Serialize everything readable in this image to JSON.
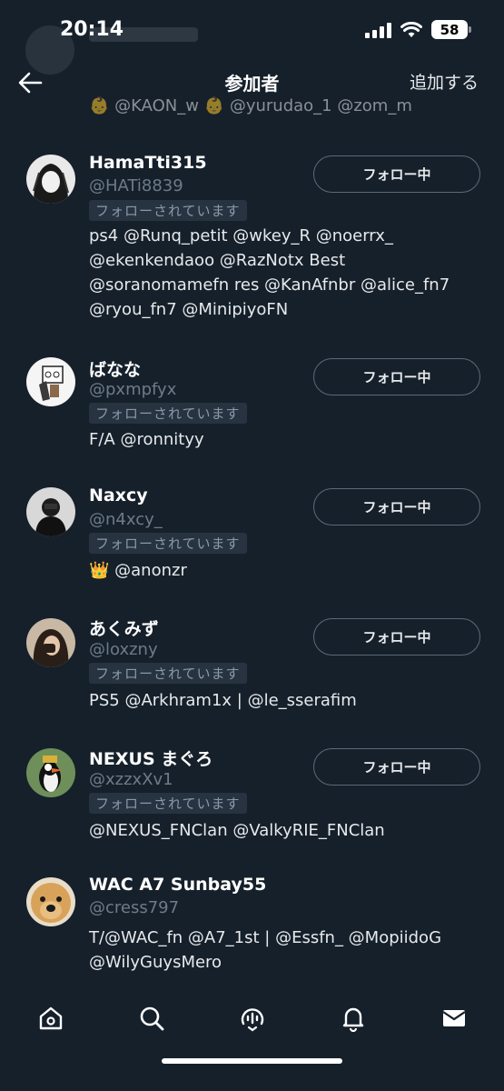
{
  "status_bar": {
    "time": "20:14",
    "battery": "58"
  },
  "nav": {
    "title": "参加者",
    "action": "追加する"
  },
  "partial_bio": "👶 @KAON_w 👶 @yurudao_1 @zom_m",
  "follows_you_label": "フォローされています",
  "following_label": "フォロー中",
  "users": [
    {
      "name": "HamaTti315",
      "handle": "@HATi8839",
      "follows_you": true,
      "following": true,
      "bio": "ps4 @Runq_petit @wkey_R @noerrx_ @ekenkendaoo @RazNotx Best @soranomamefn res @KanAfnbr @alice_fn7 @ryou_fn7 @MinipiyoFN"
    },
    {
      "name": "ばなな",
      "handle": "@pxmpfyx",
      "follows_you": true,
      "following": true,
      "bio": "F/A @ronnityy"
    },
    {
      "name": "Naxcy",
      "handle": "@n4xcy_",
      "follows_you": true,
      "following": true,
      "bio": "👑 @anonzr"
    },
    {
      "name": "あくみず",
      "handle": "@loxzny",
      "follows_you": true,
      "following": true,
      "bio": "PS5 @Arkhram1x | @le_sserafim"
    },
    {
      "name": "NEXUS まぐろ",
      "handle": "@xzzxXv1",
      "follows_you": true,
      "following": true,
      "bio": "@NEXUS_FNClan @ValkyRIE_FNClan"
    },
    {
      "name": "WAC A7 Sunbay55",
      "handle": "@cress797",
      "follows_you": false,
      "following": false,
      "bio": "T/@WAC_fn @A7_1st | @Essfn_ @MopiidoG @WilyGuysMero"
    }
  ],
  "tabs": [
    "home-icon",
    "search-icon",
    "spaces-icon",
    "notifications-icon",
    "messages-icon"
  ],
  "colors": {
    "background": "#15202b",
    "secondary_text": "#6e7b87",
    "badge_bg": "#273340"
  }
}
